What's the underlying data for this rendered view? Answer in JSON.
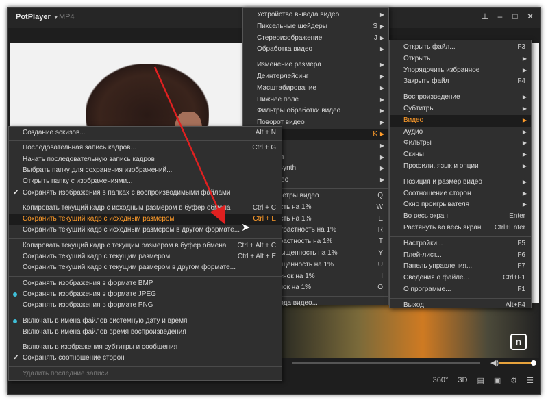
{
  "app": {
    "title": "PotPlayer",
    "format": "MP4"
  },
  "window_controls": [
    "pin-icon",
    "minimize-icon",
    "restore-icon",
    "close-icon"
  ],
  "bottom_icons": {
    "vr": "360°",
    "three_d": "3D"
  },
  "video_menu": {
    "items": [
      {
        "label": "Устройство вывода видео",
        "arrow": true
      },
      {
        "label": "Пиксельные шейдеры",
        "shortcut": "S",
        "arrow": true
      },
      {
        "label": "Стереоизображение",
        "shortcut": "J",
        "arrow": true
      },
      {
        "label": "Обработка видео",
        "arrow": true
      },
      {
        "sep": true
      },
      {
        "label": "Изменение размера",
        "arrow": true
      },
      {
        "label": "Деинтерлейсинг",
        "arrow": true
      },
      {
        "label": "Масштабирование",
        "arrow": true
      },
      {
        "label": "Нижнее поле",
        "arrow": true
      },
      {
        "label": "Фильтры обработки видео",
        "arrow": true
      },
      {
        "label": "Поворот видео",
        "arrow": true
      },
      {
        "label": "кадров",
        "shortcut": "K",
        "arrow": true,
        "highlight": true
      },
      {
        "label": "ideo",
        "arrow": true
      },
      {
        "label": "AviSynth",
        "arrow": true
      },
      {
        "label": "VapourSynth",
        "arrow": true
      },
      {
        "label": "60°-видео",
        "arrow": true
      },
      {
        "sep": true
      },
      {
        "label": "е параметры видео",
        "shortcut": "Q"
      },
      {
        "label": "ть яркость на 1%",
        "shortcut": "W"
      },
      {
        "label": "ть яркость на 1%",
        "shortcut": "E"
      },
      {
        "label": "ить контрастность на 1%",
        "shortcut": "R"
      },
      {
        "label": "ть контрастность на 1%",
        "shortcut": "T"
      },
      {
        "label": "ить насыщенность на 1%",
        "shortcut": "Y"
      },
      {
        "label": "ть насыщенность на 1%",
        "shortcut": "U"
      },
      {
        "label": "ить оттенок на 1%",
        "shortcut": "I"
      },
      {
        "label": "ть оттенок на 1%",
        "shortcut": "O"
      },
      {
        "sep": true
      },
      {
        "label": "ры вывода видео..."
      }
    ]
  },
  "main_menu": {
    "items": [
      {
        "label": "Открыть файл...",
        "shortcut": "F3"
      },
      {
        "label": "Открыть",
        "arrow": true
      },
      {
        "label": "Упорядочить избранное",
        "arrow": true
      },
      {
        "label": "Закрыть файл",
        "shortcut": "F4"
      },
      {
        "sep": true
      },
      {
        "label": "Воспроизведение",
        "arrow": true
      },
      {
        "label": "Субтитры",
        "arrow": true
      },
      {
        "label": "Видео",
        "arrow": true,
        "highlight": true
      },
      {
        "label": "Аудио",
        "arrow": true
      },
      {
        "label": "Фильтры",
        "arrow": true
      },
      {
        "label": "Скины",
        "arrow": true
      },
      {
        "label": "Профили, язык и опции",
        "arrow": true
      },
      {
        "sep": true
      },
      {
        "label": "Позиция и размер видео",
        "arrow": true
      },
      {
        "label": "Соотношение сторон",
        "arrow": true
      },
      {
        "label": "Окно проигрывателя",
        "arrow": true
      },
      {
        "label": "Во весь экран",
        "shortcut": "Enter"
      },
      {
        "label": "Растянуть во весь экран",
        "shortcut": "Ctrl+Enter"
      },
      {
        "sep": true
      },
      {
        "label": "Настройки...",
        "shortcut": "F5"
      },
      {
        "label": "Плей-лист...",
        "shortcut": "F6"
      },
      {
        "label": "Панель управления...",
        "shortcut": "F7"
      },
      {
        "label": "Сведения о файле...",
        "shortcut": "Ctrl+F1"
      },
      {
        "label": "О программе...",
        "shortcut": "F1"
      },
      {
        "sep": true
      },
      {
        "label": "Выход",
        "shortcut": "Alt+F4"
      }
    ]
  },
  "capture_menu": {
    "items": [
      {
        "label": "Создание эскизов...",
        "shortcut": "Alt + N"
      },
      {
        "sep": true
      },
      {
        "label": "Последовательная запись кадров...",
        "shortcut": "Ctrl + G"
      },
      {
        "label": "Начать последовательную запись кадров"
      },
      {
        "label": "Выбрать папку для сохранения изображений..."
      },
      {
        "label": "Открыть папку с изображениями..."
      },
      {
        "label": "Сохранять изображения в папках с воспроизводимыми файлами",
        "check": true
      },
      {
        "sep": true
      },
      {
        "label": "Копировать текущий кадр с исходным размером в буфер обмена",
        "shortcut": "Ctrl + C"
      },
      {
        "label": "Сохранить текущий кадр с исходным размером",
        "shortcut": "Ctrl + E",
        "highlight": true
      },
      {
        "label": "Сохранить текущий кадр с исходным размером в другом формате..."
      },
      {
        "sep": true
      },
      {
        "label": "Копировать текущий кадр с текущим размером в буфер обмена",
        "shortcut": "Ctrl + Alt + C"
      },
      {
        "label": "Сохранить текущий кадр с текущим размером",
        "shortcut": "Ctrl + Alt + E"
      },
      {
        "label": "Сохранить текущий кадр с текущим размером в другом формате..."
      },
      {
        "sep": true
      },
      {
        "label": "Сохранять изображения в формате BMP"
      },
      {
        "label": "Сохранять изображения в формате JPEG",
        "radio": true
      },
      {
        "label": "Сохранять изображения в формате PNG"
      },
      {
        "sep": true
      },
      {
        "label": "Включать в имена файлов системную дату и время",
        "radio": true
      },
      {
        "label": "Включать в имена файлов время воспроизведения"
      },
      {
        "sep": true
      },
      {
        "label": "Включать в изображения субтитры и сообщения"
      },
      {
        "label": "Сохранять соотношение сторон",
        "check": true
      },
      {
        "sep": true
      },
      {
        "label": "Удалить последние записи",
        "disabled": true
      }
    ]
  },
  "colors": {
    "accent": "#ff9c2a",
    "radio": "#3fbfd8",
    "arrow": "#e02020"
  }
}
